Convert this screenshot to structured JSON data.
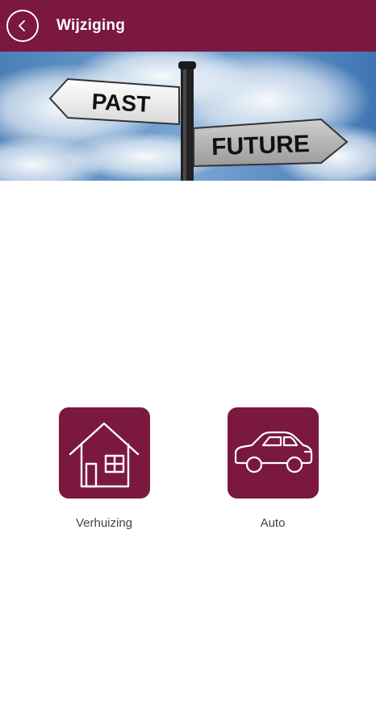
{
  "header": {
    "title": "Wijziging",
    "back_icon": "chevron-left-icon"
  },
  "banner": {
    "sign_left": "PAST",
    "sign_right": "FUTURE"
  },
  "options": [
    {
      "label": "Verhuizing",
      "icon": "house-icon"
    },
    {
      "label": "Auto",
      "icon": "car-icon"
    }
  ],
  "colors": {
    "brand": "#7a1840",
    "label_text": "#444444"
  }
}
